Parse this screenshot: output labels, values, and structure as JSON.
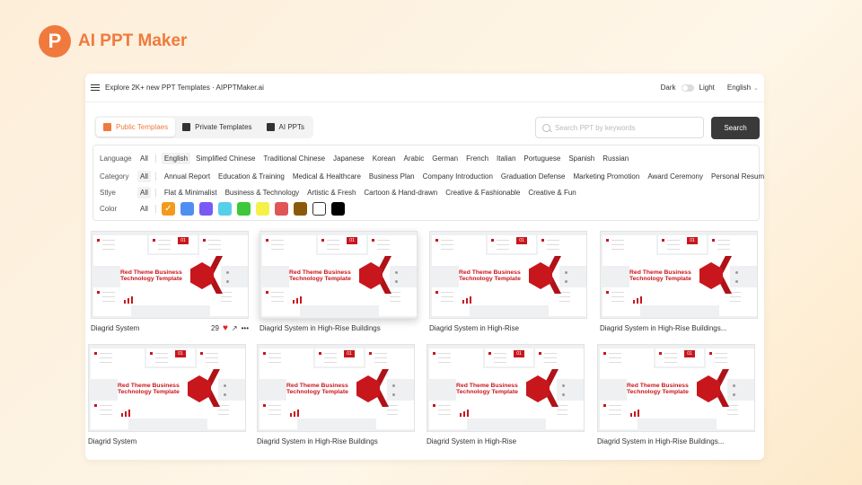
{
  "brand": {
    "mark": "P",
    "name": "AI PPT Maker"
  },
  "topbar": {
    "title": "Explore 2K+ new PPT Templates · AIPPTMaker.ai",
    "dark_label": "Dark",
    "light_label": "Light",
    "language": "English"
  },
  "tabs": [
    {
      "label": "Public Templaes"
    },
    {
      "label": "Private Templates"
    },
    {
      "label": "AI PPTs"
    }
  ],
  "search": {
    "placeholder": "Search PPT by keywords",
    "button": "Search"
  },
  "filters": {
    "language": {
      "label": "Language",
      "all": "All",
      "options": [
        "English",
        "Simplified Chinese",
        "Traditional Chinese",
        "Japanese",
        "Korean",
        "Arabic",
        "German",
        "French",
        "Italian",
        "Portuguese",
        "Spanish",
        "Russian"
      ]
    },
    "category": {
      "label": "Category",
      "all": "All",
      "options": [
        "Annual Report",
        "Education & Training",
        "Medical & Healthcare",
        "Business Plan",
        "Company Introduction",
        "Graduation Defense",
        "Marketing Promotion",
        "Award Ceremony",
        "Personal Resume"
      ]
    },
    "style": {
      "label": "Stlye",
      "all": "All",
      "options": [
        "Flat & Minimalist",
        "Business & Technology",
        "Artistic & Fresh",
        "Cartoon & Hand-drawn",
        "Creative & Fashionable",
        "Creative & Fun"
      ]
    },
    "color": {
      "label": "Color",
      "all": "All",
      "swatches": [
        "#f39a1e",
        "#4f8ff0",
        "#7a5af5",
        "#56d0e8",
        "#3cc83a",
        "#f5f04a",
        "#e05555",
        "#8a5a0a",
        "#ffffff",
        "#000000"
      ]
    }
  },
  "templates": [
    {
      "name": "Diagrid System",
      "thumb_title": "Red Theme Business Technology Template",
      "likes": "29",
      "slide_num": "01"
    },
    {
      "name": "Diagrid System in High-Rise Buildings",
      "thumb_title": "Red Theme Business Technology Template",
      "slide_num": "01"
    },
    {
      "name": "Diagrid System in High-Rise",
      "thumb_title": "Red Theme Business Technology Template",
      "slide_num": "01"
    },
    {
      "name": "Diagrid System in High-Rise Buildings...",
      "thumb_title": "Red Theme Business Technology Template",
      "slide_num": "01"
    },
    {
      "name": "Diagrid System",
      "thumb_title": "Red Theme Business Technology Template",
      "slide_num": "01"
    },
    {
      "name": "Diagrid System in High-Rise Buildings",
      "thumb_title": "Red Theme Business Technology Template",
      "slide_num": "01"
    },
    {
      "name": "Diagrid System in High-Rise",
      "thumb_title": "Red Theme Business Technology Template",
      "slide_num": "01"
    },
    {
      "name": "Diagrid System in High-Rise Buildings...",
      "thumb_title": "Red Theme Business Technology Template",
      "slide_num": "01"
    }
  ],
  "colors": {
    "accent": "#f07a3e",
    "theme_red": "#c8161d"
  }
}
